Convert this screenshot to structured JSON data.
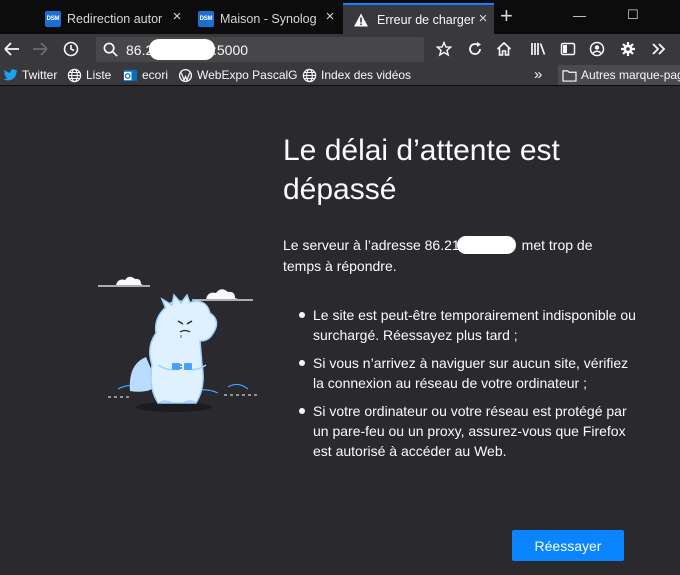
{
  "tabs": [
    {
      "favicon": "DSM",
      "title": "Redirection autor"
    },
    {
      "favicon": "DSM",
      "title": "Maison - Synolog"
    },
    {
      "favicon": "warning-icon",
      "title": "Erreur de charger"
    }
  ],
  "window": {
    "minimize": "—",
    "maximize": "☐"
  },
  "url": {
    "prefix": "86.2",
    "suffix": ":5000"
  },
  "bookmarks": [
    {
      "label": "Twitter",
      "icon": "twitter-icon"
    },
    {
      "label": "Liste",
      "icon": "globe-icon"
    },
    {
      "label": "ecori",
      "icon": "outlook-icon"
    },
    {
      "label": "WebExpo PascalG",
      "icon": "wordpress-icon"
    },
    {
      "label": "Index des vidéos",
      "icon": "globe-icon"
    }
  ],
  "other_bookmarks": "Autres marque-pages",
  "error": {
    "title": "Le délai d’attente est dépassé",
    "desc_start": "Le serveur à l’adresse 86.21",
    "desc_end": "met trop de temps à répondre.",
    "bullets": [
      "Le site est peut-être temporairement indisponible ou surchargé. Réessayez plus tard ;",
      "Si vous n’arrivez à naviguer sur aucun site, vérifiez la connexion au réseau de votre ordinateur ;",
      "Si votre ordinateur ou votre réseau est protégé par un pare-feu ou un proxy, assurez-vous que Firefox est autorisé à accéder au Web."
    ],
    "retry_label": "Réessayer"
  },
  "colors": {
    "accent": "#0a84ff",
    "page_bg": "#2a2a2e",
    "toolbar_bg": "#38383d",
    "tabstrip_bg": "#0c0c0d"
  }
}
